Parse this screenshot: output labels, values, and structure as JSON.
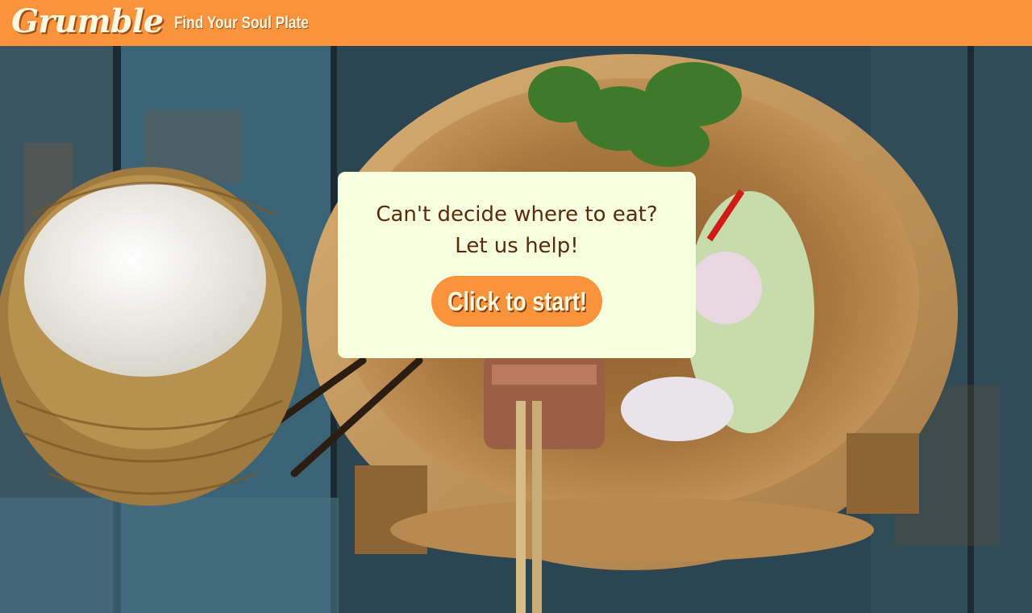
{
  "header": {
    "brand": "Grumble",
    "tagline": "Find Your Soul Plate"
  },
  "card": {
    "line1": "Can't decide where to eat?",
    "line2": "Let us help!",
    "start_button": "Click to start!"
  },
  "colors": {
    "navbar": "#f9933c",
    "card_bg": "#f8ffdf",
    "card_text": "#5a2a0c",
    "button_bg": "#f9933c",
    "button_text": "#fff7df"
  },
  "hero_image": {
    "icon": "food-photo",
    "subject": "sticky rice basket, grilled pork skewers, herbs and cabbage in a wooden bowl on a blue wooden table"
  }
}
